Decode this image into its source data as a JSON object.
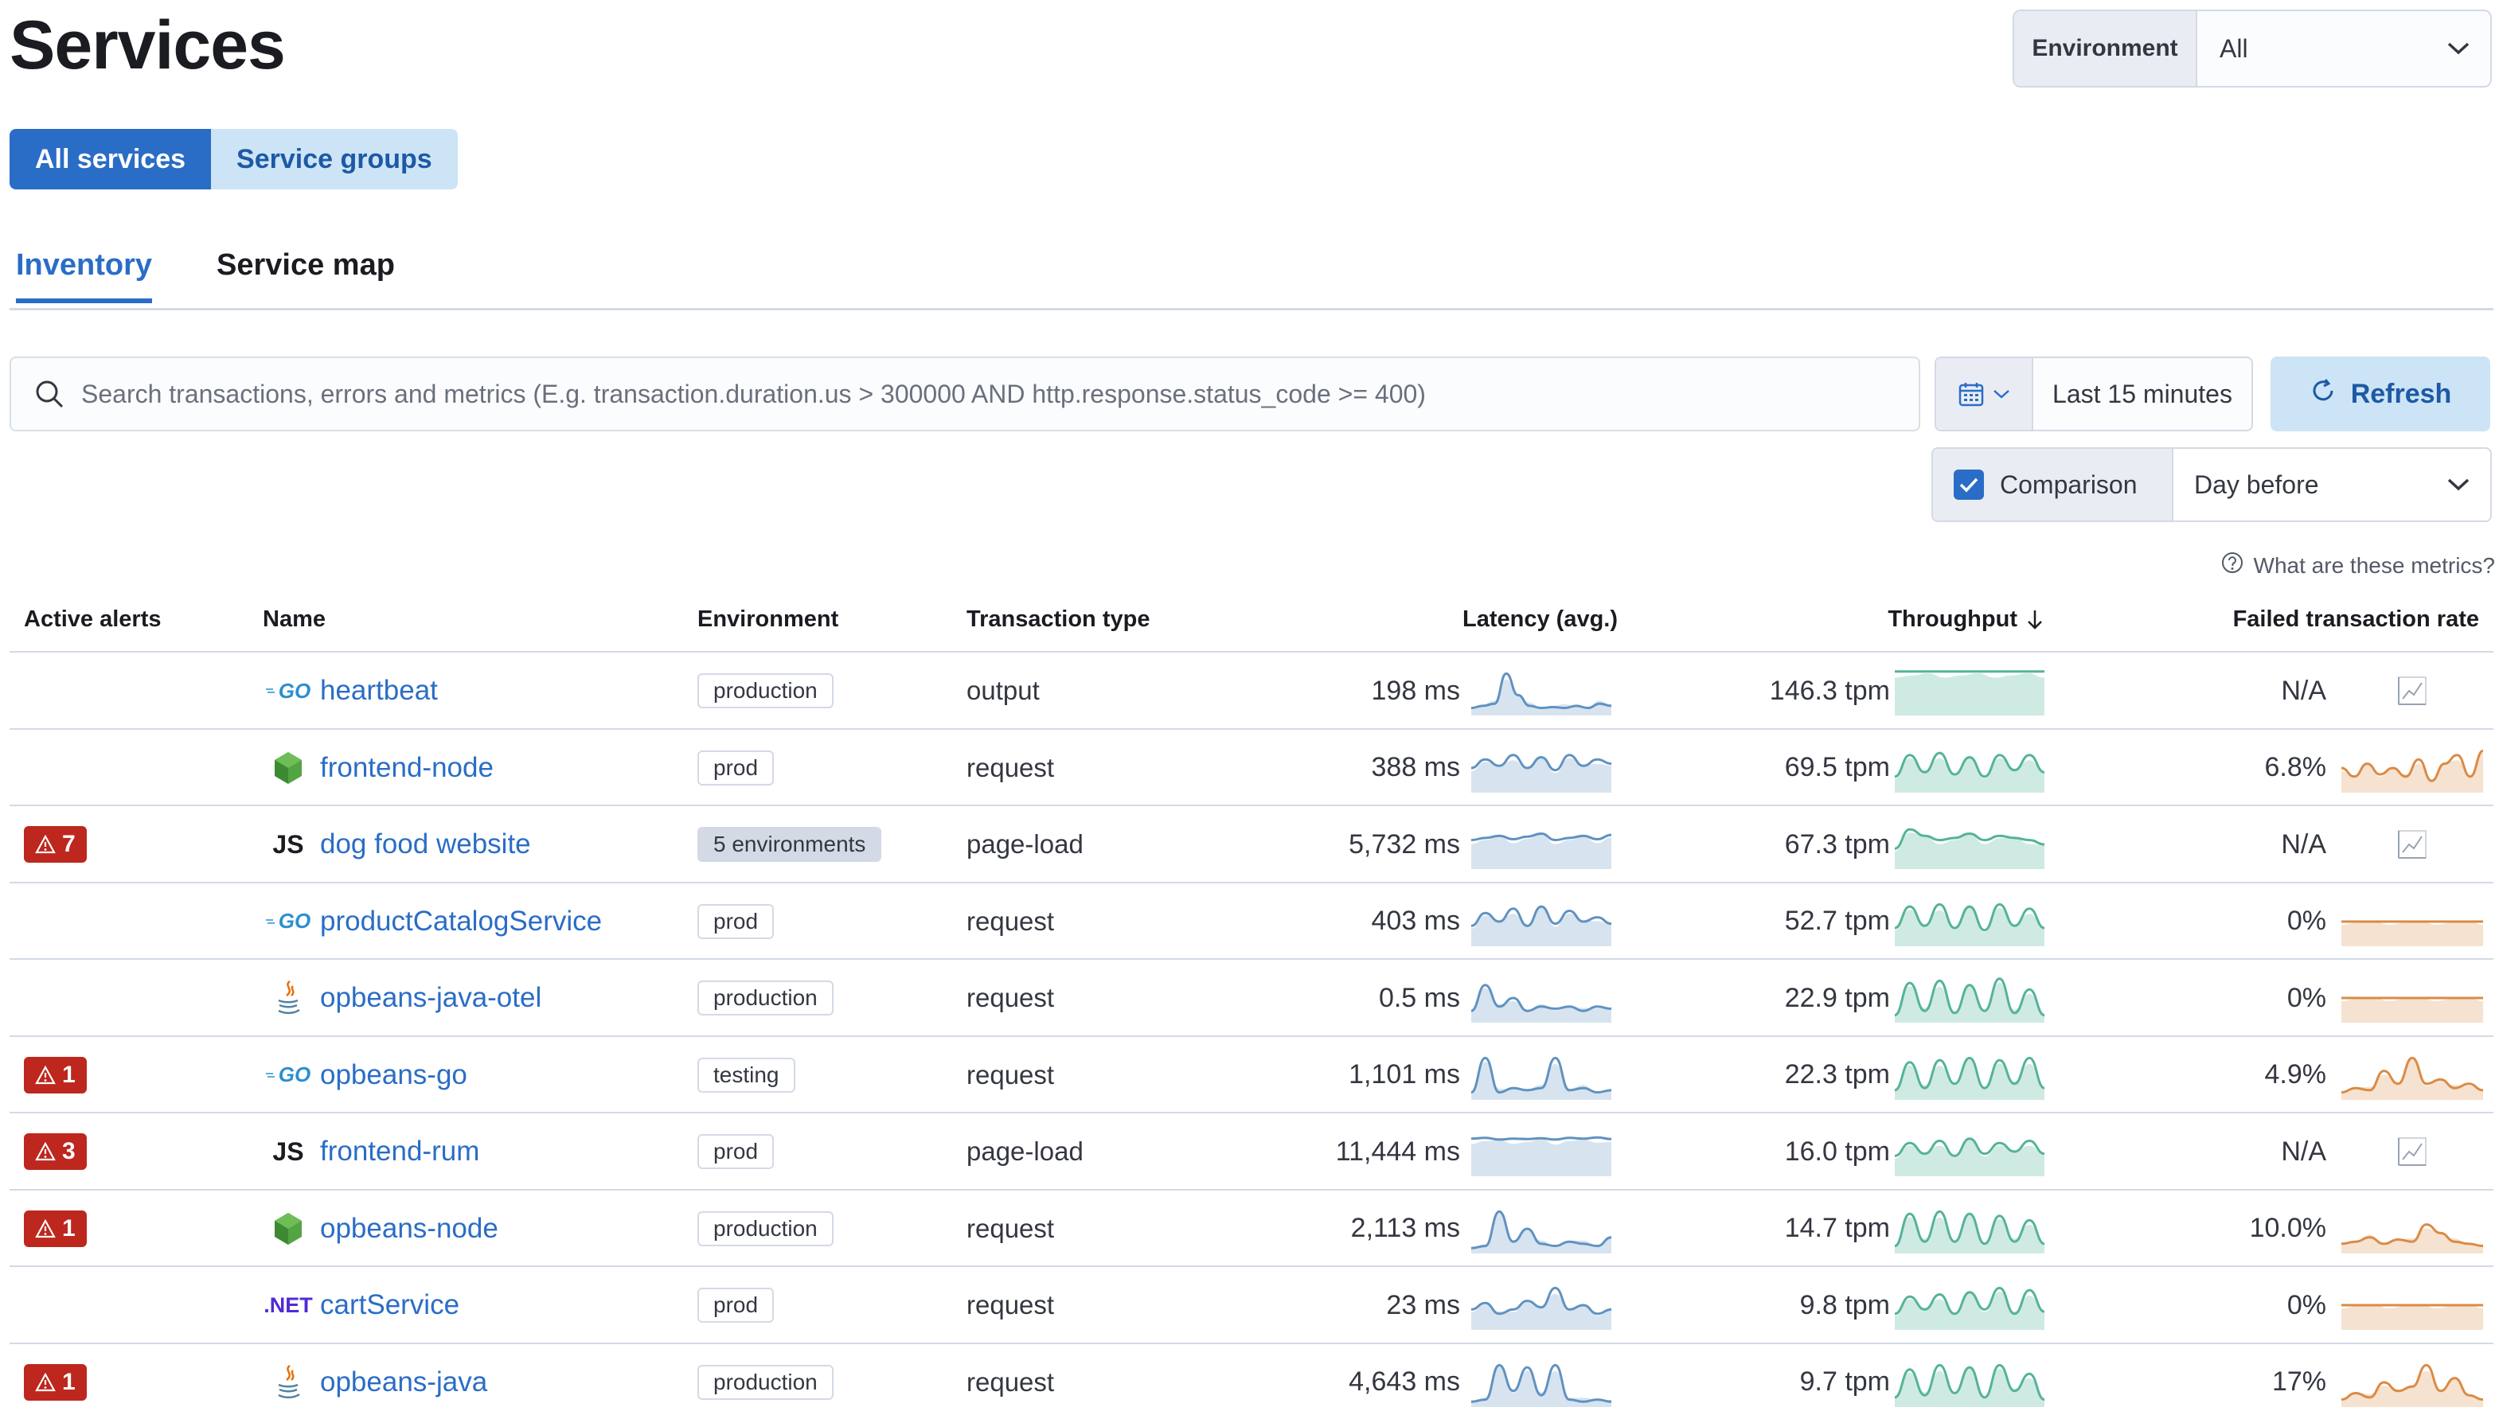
{
  "page_title": "Services",
  "environment": {
    "label": "Environment",
    "value": "All"
  },
  "service_view": {
    "all_services": "All services",
    "service_groups": "Service groups"
  },
  "tabs": {
    "inventory": "Inventory",
    "service_map": "Service map"
  },
  "search": {
    "placeholder": "Search transactions, errors and metrics (E.g. transaction.duration.us > 300000 AND http.response.status_code >= 400)"
  },
  "date_range": "Last 15 minutes",
  "refresh_label": "Refresh",
  "comparison": {
    "label": "Comparison",
    "enabled": true,
    "value": "Day before"
  },
  "metrics_help": "What are these metrics?",
  "colors": {
    "primary": "#2a6dc6",
    "danger": "#bd271e",
    "latency": "#6092c0",
    "throughput": "#54b399",
    "failed": "#da8b45"
  },
  "columns": {
    "active_alerts": "Active alerts",
    "name": "Name",
    "environment": "Environment",
    "transaction_type": "Transaction type",
    "latency": "Latency (avg.)",
    "throughput": "Throughput",
    "failed_rate": "Failed transaction rate"
  },
  "services": [
    {
      "alerts": "",
      "agent": "go",
      "agent_label": "GO",
      "name": "heartbeat",
      "environment": "production",
      "transaction_type": "output",
      "latency": "198 ms",
      "throughput": "146.3 tpm",
      "failed_rate": "N/A",
      "latency_trend": [
        0.1,
        0.15,
        0.2,
        0.9,
        0.4,
        0.15,
        0.1,
        0.12,
        0.1,
        0.15,
        0.1,
        0.2,
        0.15
      ],
      "throughput_trend": [
        0.95,
        0.95,
        0.95,
        0.95,
        0.95,
        0.95,
        0.95,
        0.95,
        0.95,
        0.95
      ],
      "failed_trend": null
    },
    {
      "alerts": "",
      "agent": "node",
      "agent_label": "",
      "name": "frontend-node",
      "environment": "prod",
      "transaction_type": "request",
      "latency": "388 ms",
      "throughput": "69.5 tpm",
      "failed_rate": "6.8%",
      "latency_trend": [
        0.5,
        0.7,
        0.55,
        0.8,
        0.5,
        0.75,
        0.45,
        0.8,
        0.55,
        0.7,
        0.6
      ],
      "throughput_trend": [
        0.3,
        0.8,
        0.4,
        0.85,
        0.35,
        0.75,
        0.3,
        0.8,
        0.45,
        0.8,
        0.4
      ],
      "failed_trend": [
        0.5,
        0.3,
        0.6,
        0.35,
        0.5,
        0.3,
        0.7,
        0.2,
        0.6,
        0.8,
        0.3,
        0.9
      ]
    },
    {
      "alerts": "7",
      "agent": "js",
      "agent_label": "JS",
      "name": "dog food website",
      "environment": "5 environments",
      "transaction_type": "page-load",
      "latency": "5,732 ms",
      "throughput": "67.3 tpm",
      "failed_rate": "N/A",
      "latency_trend": [
        0.6,
        0.65,
        0.7,
        0.62,
        0.68,
        0.75,
        0.6,
        0.65,
        0.7,
        0.62,
        0.72
      ],
      "throughput_trend": [
        0.4,
        0.85,
        0.7,
        0.6,
        0.65,
        0.75,
        0.6,
        0.7,
        0.65,
        0.6,
        0.5
      ],
      "failed_trend": null
    },
    {
      "alerts": "",
      "agent": "go",
      "agent_label": "GO",
      "name": "productCatalogService",
      "environment": "prod",
      "transaction_type": "request",
      "latency": "403 ms",
      "throughput": "52.7 tpm",
      "failed_rate": "0%",
      "latency_trend": [
        0.4,
        0.7,
        0.5,
        0.8,
        0.4,
        0.85,
        0.45,
        0.75,
        0.5,
        0.6,
        0.45
      ],
      "throughput_trend": [
        0.35,
        0.85,
        0.4,
        0.9,
        0.35,
        0.85,
        0.3,
        0.9,
        0.4,
        0.8,
        0.35
      ],
      "failed_trend": [
        0.5,
        0.5,
        0.5,
        0.5,
        0.5,
        0.5,
        0.5,
        0.5,
        0.5,
        0.5
      ]
    },
    {
      "alerts": "",
      "agent": "java",
      "agent_label": "",
      "name": "opbeans-java-otel",
      "environment": "production",
      "transaction_type": "request",
      "latency": "0.5 ms",
      "throughput": "22.9 tpm",
      "failed_rate": "0%",
      "latency_trend": [
        0.2,
        0.8,
        0.3,
        0.5,
        0.2,
        0.3,
        0.25,
        0.3,
        0.2,
        0.3,
        0.25
      ],
      "throughput_trend": [
        0.1,
        0.85,
        0.2,
        0.9,
        0.15,
        0.8,
        0.2,
        0.95,
        0.15,
        0.7,
        0.1
      ],
      "failed_trend": [
        0.5,
        0.5,
        0.5,
        0.5,
        0.5,
        0.5,
        0.5,
        0.5,
        0.5,
        0.5
      ]
    },
    {
      "alerts": "1",
      "agent": "go",
      "agent_label": "GO",
      "name": "opbeans-go",
      "environment": "testing",
      "transaction_type": "request",
      "latency": "1,101 ms",
      "throughput": "22.3 tpm",
      "failed_rate": "4.9%",
      "latency_trend": [
        0.1,
        0.9,
        0.1,
        0.2,
        0.15,
        0.2,
        0.9,
        0.15,
        0.2,
        0.1,
        0.15
      ],
      "throughput_trend": [
        0.15,
        0.8,
        0.2,
        0.85,
        0.3,
        0.9,
        0.2,
        0.85,
        0.3,
        0.9,
        0.2
      ],
      "failed_trend": [
        0.1,
        0.2,
        0.15,
        0.6,
        0.3,
        0.9,
        0.3,
        0.4,
        0.2,
        0.3,
        0.15
      ]
    },
    {
      "alerts": "3",
      "agent": "js",
      "agent_label": "JS",
      "name": "frontend-rum",
      "environment": "prod",
      "transaction_type": "page-load",
      "latency": "11,444 ms",
      "throughput": "16.0 tpm",
      "failed_rate": "N/A",
      "latency_trend": [
        0.8,
        0.82,
        0.78,
        0.8,
        0.79,
        0.81,
        0.78,
        0.82,
        0.8,
        0.83,
        0.79
      ],
      "throughput_trend": [
        0.4,
        0.7,
        0.45,
        0.75,
        0.4,
        0.8,
        0.45,
        0.7,
        0.5,
        0.75,
        0.45
      ],
      "failed_trend": null
    },
    {
      "alerts": "1",
      "agent": "node",
      "agent_label": "",
      "name": "opbeans-node",
      "environment": "production",
      "transaction_type": "request",
      "latency": "2,113 ms",
      "throughput": "14.7 tpm",
      "failed_rate": "10.0%",
      "latency_trend": [
        0.05,
        0.1,
        0.9,
        0.2,
        0.5,
        0.15,
        0.1,
        0.2,
        0.15,
        0.1,
        0.3
      ],
      "throughput_trend": [
        0.1,
        0.85,
        0.2,
        0.9,
        0.2,
        0.85,
        0.15,
        0.8,
        0.2,
        0.7,
        0.15
      ],
      "failed_trend": [
        0.15,
        0.2,
        0.3,
        0.15,
        0.25,
        0.2,
        0.6,
        0.4,
        0.2,
        0.15,
        0.1
      ]
    },
    {
      "alerts": "",
      "agent": "dotnet",
      "agent_label": ".NET",
      "name": "cartService",
      "environment": "prod",
      "transaction_type": "request",
      "latency": "23 ms",
      "throughput": "9.8 tpm",
      "failed_rate": "0%",
      "latency_trend": [
        0.4,
        0.55,
        0.3,
        0.4,
        0.6,
        0.45,
        0.9,
        0.4,
        0.5,
        0.3,
        0.4
      ],
      "throughput_trend": [
        0.3,
        0.7,
        0.4,
        0.75,
        0.3,
        0.8,
        0.4,
        0.9,
        0.3,
        0.85,
        0.35
      ],
      "failed_trend": [
        0.5,
        0.5,
        0.5,
        0.5,
        0.5,
        0.5,
        0.5,
        0.5,
        0.5,
        0.5
      ]
    },
    {
      "alerts": "1",
      "agent": "java",
      "agent_label": "",
      "name": "opbeans-java",
      "environment": "production",
      "transaction_type": "request",
      "latency": "4,643 ms",
      "throughput": "9.7 tpm",
      "failed_rate": "17%",
      "latency_trend": [
        0.05,
        0.1,
        0.9,
        0.3,
        0.85,
        0.2,
        0.9,
        0.1,
        0.05,
        0.1,
        0.05
      ],
      "throughput_trend": [
        0.15,
        0.8,
        0.2,
        0.9,
        0.25,
        0.85,
        0.15,
        0.9,
        0.3,
        0.7,
        0.1
      ],
      "failed_trend": [
        0.1,
        0.25,
        0.15,
        0.5,
        0.3,
        0.4,
        0.9,
        0.3,
        0.6,
        0.2,
        0.1
      ]
    }
  ]
}
